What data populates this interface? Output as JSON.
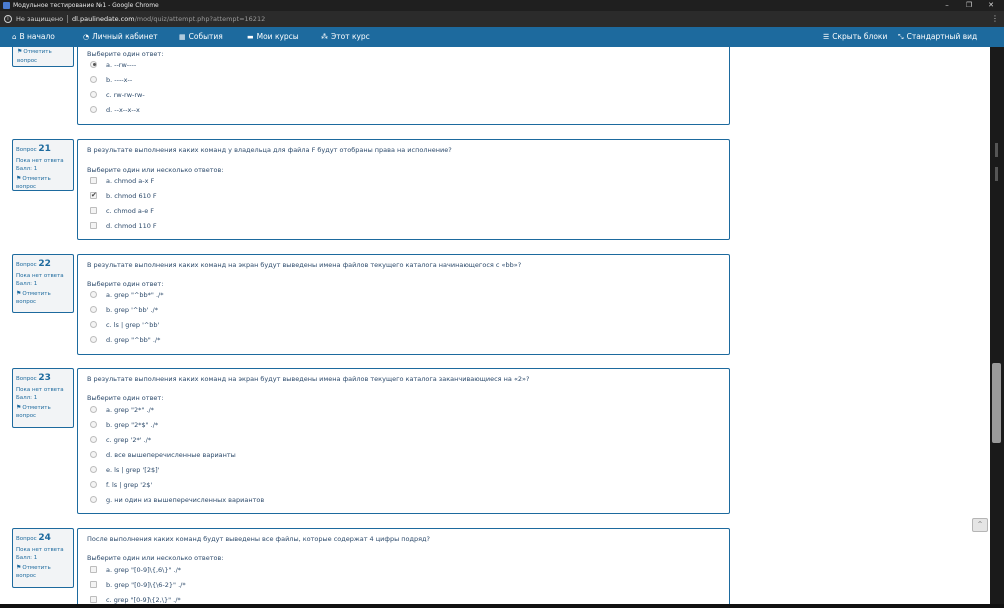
{
  "window": {
    "title": "Модульное тестирование №1 - Google Chrome",
    "controls": [
      "–",
      "❐",
      "✕"
    ]
  },
  "address": {
    "security_label": "Не защищено",
    "host": "dl.paulinedate.com",
    "path": "/mod/quiz/attempt.php?attempt=16212"
  },
  "nav": {
    "home": "В начало",
    "cabinet": "Личный кабинет",
    "events": "События",
    "courses": "Мои курсы",
    "this_course": "Этот курс",
    "hide_blocks": "Скрыть блоки",
    "standard_view": "Стандартный вид"
  },
  "questions": [
    {
      "number": "",
      "status": "",
      "score": "",
      "flag": "Отметить вопрос",
      "text": "",
      "prompt": "Выберите один ответ:",
      "type": "radio",
      "options": [
        {
          "label": "a. --rw----",
          "checked": true
        },
        {
          "label": "b. ----x--",
          "checked": false
        },
        {
          "label": "c. rw-rw-rw-",
          "checked": false
        },
        {
          "label": "d. --x--x--x",
          "checked": false
        }
      ]
    },
    {
      "number": "21",
      "label": "Вопрос",
      "status": "Пока нет ответа",
      "score": "Балл: 1",
      "flag": "Отметить вопрос",
      "text": "В результате выполнения каких команд у владельца для файла F будут отобраны права на исполнение?",
      "prompt": "Выберите один или несколько ответов:",
      "type": "checkbox",
      "options": [
        {
          "label": "a. chmod a-x F",
          "checked": false
        },
        {
          "label": "b. chmod 610 F",
          "checked": true
        },
        {
          "label": "c. chmod a-e F",
          "checked": false
        },
        {
          "label": "d. chmod 110 F",
          "checked": false
        }
      ]
    },
    {
      "number": "22",
      "label": "Вопрос",
      "status": "Пока нет ответа",
      "score": "Балл: 1",
      "flag": "Отметить вопрос",
      "text": "В результате выполнения каких команд на экран будут выведены имена файлов текущего каталога начинающегося с «bb»?",
      "prompt": "Выберите один ответ:",
      "type": "radio",
      "options": [
        {
          "label": "a. grep \"^bb*\" ./*",
          "checked": false
        },
        {
          "label": "b. grep '^bb' ./*",
          "checked": false
        },
        {
          "label": "c. ls | grep '^bb'",
          "checked": false
        },
        {
          "label": "d. grep \"^bb\" ./*",
          "checked": false
        }
      ]
    },
    {
      "number": "23",
      "label": "Вопрос",
      "status": "Пока нет ответа",
      "score": "Балл: 1",
      "flag": "Отметить вопрос",
      "text": "В результате выполнения каких команд на экран будут выведены имена файлов текущего каталога заканчивающиеся на «2»?",
      "prompt": "Выберите один ответ:",
      "type": "radio",
      "options": [
        {
          "label": "a. grep \"2*\" ./*",
          "checked": false
        },
        {
          "label": "b. grep \"2*$\" ./*",
          "checked": false
        },
        {
          "label": "c. grep '2*' ./*",
          "checked": false
        },
        {
          "label": "d. все вышеперечисленные варианты",
          "checked": false
        },
        {
          "label": "e. ls | grep '[2$]'",
          "checked": false
        },
        {
          "label": "f. ls | grep '2$'",
          "checked": false
        },
        {
          "label": "g. ни один из вышеперечисленных вариантов",
          "checked": false
        }
      ]
    },
    {
      "number": "24",
      "label": "Вопрос",
      "status": "Пока нет ответа",
      "score": "Балл: 1",
      "flag": "Отметить вопрос",
      "text": "После выполнения каких команд будут выведены все файлы, которые содержат 4 цифры подряд?",
      "prompt": "Выберите один или несколько ответов:",
      "type": "checkbox",
      "options": [
        {
          "label": "a. grep \"[0-9]\\{,6\\}\" ./*",
          "checked": false
        },
        {
          "label": "b. grep \"[0-9]\\{\\6-2}\" ./*",
          "checked": false
        },
        {
          "label": "c. grep \"[0-9]\\{2,\\}\" ./*",
          "checked": false
        }
      ]
    }
  ],
  "back_to_top": "^"
}
